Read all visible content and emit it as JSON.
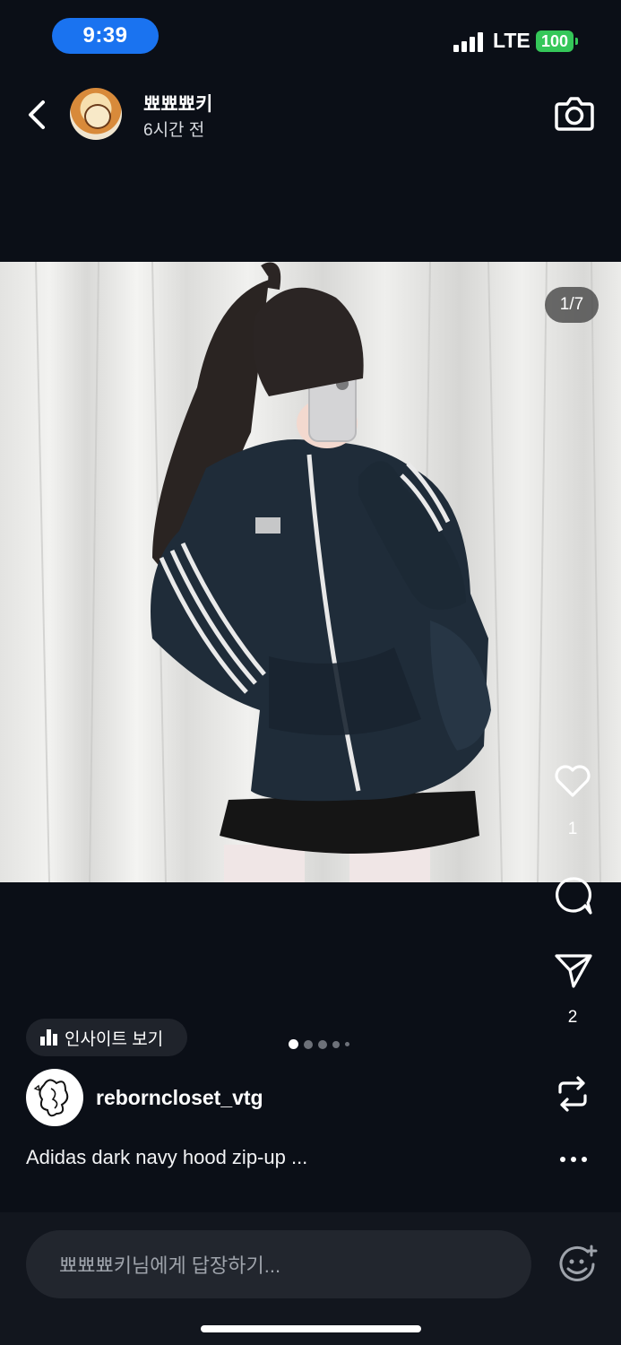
{
  "status_bar": {
    "time": "9:39",
    "network": "LTE",
    "battery": "100"
  },
  "header": {
    "username": "뾰뾰뾰키",
    "time_ago": "6시간 전"
  },
  "post": {
    "image_counter": "1/7"
  },
  "actions": {
    "likes": "1",
    "shares": "2"
  },
  "insights": {
    "label": "인사이트 보기"
  },
  "owner": {
    "username": "reborncloset_vtg",
    "caption": "Adidas dark navy hood zip-up ..."
  },
  "reply": {
    "placeholder": "뾰뾰뾰키님에게 답장하기..."
  },
  "icons": [
    "back-icon",
    "camera-icon",
    "heart-icon",
    "comment-icon",
    "send-icon",
    "repost-icon",
    "more-icon",
    "emoji-add-icon",
    "insights-bar-icon",
    "signal-icon",
    "battery-icon"
  ]
}
